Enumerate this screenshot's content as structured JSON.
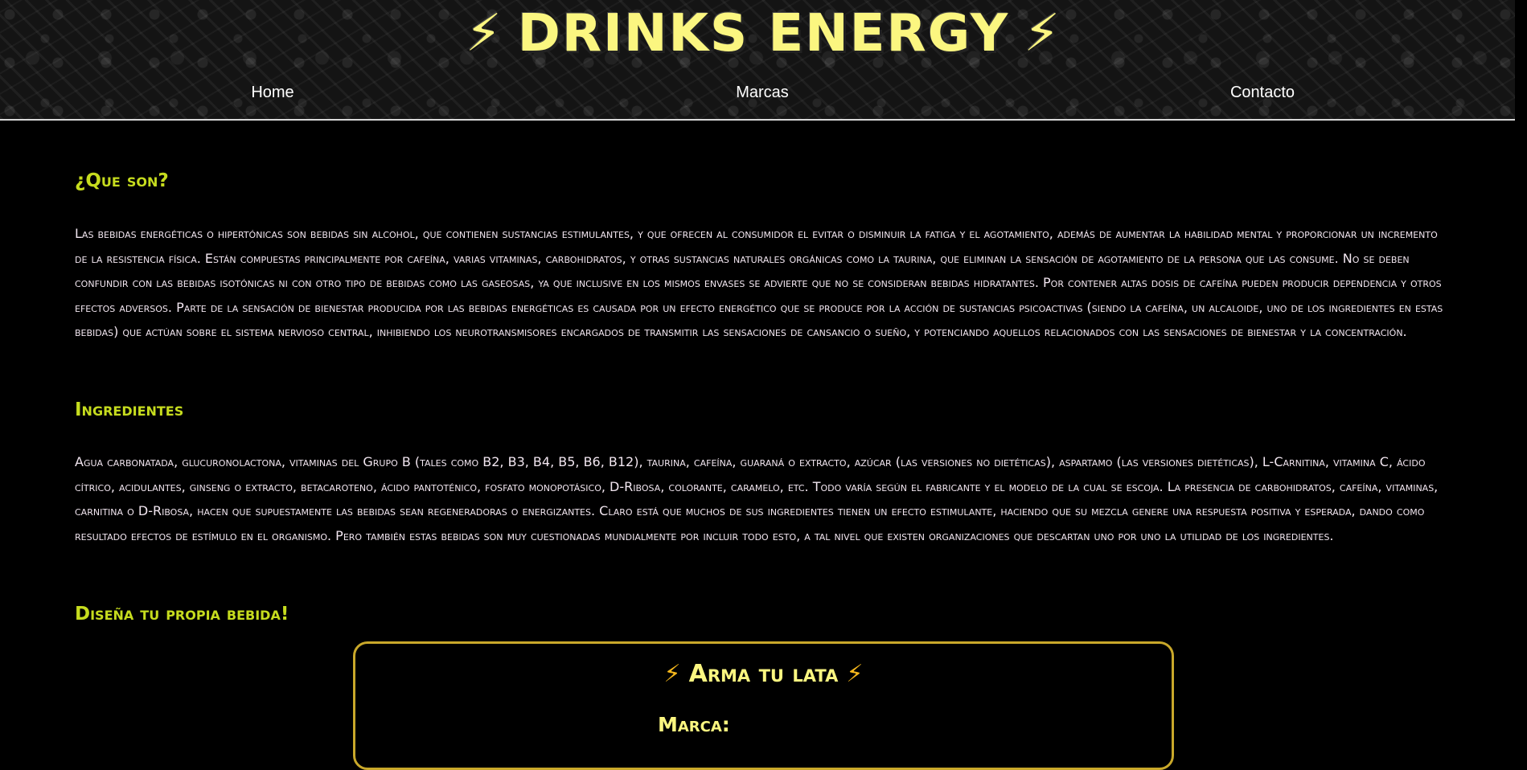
{
  "header": {
    "logo_bolt": "⚡",
    "logo_text": "DRINKS ENERGY",
    "nav": [
      {
        "label": "Home"
      },
      {
        "label": "Marcas"
      },
      {
        "label": "Contacto"
      }
    ]
  },
  "sections": [
    {
      "title": "¿Que son?",
      "text": "Las bebidas energéticas o hipertónicas son bebidas sin alcohol, que contienen sustancias estimulantes, y que ofrecen al consumidor el evitar o disminuir la fatiga y el agotamiento, además de aumentar la habilidad mental y proporcionar un incremento de la resistencia física. Están compuestas principalmente por cafeína, varias vitaminas, carbohidratos, y otras sustancias naturales orgánicas como la taurina, que eliminan la sensación de agotamiento de la persona que las consume. No se deben confundir con las bebidas isotónicas ni con otro tipo de bebidas como las gaseosas, ya que inclusive en los mismos envases se advierte que no se consideran bebidas hidratantes. Por contener altas dosis de cafeína pueden producir dependencia y otros efectos adversos. Parte de la sensación de bienestar producida por las bebidas energéticas es causada por un efecto energético que se produce por la acción de sustancias psicoactivas (siendo la cafeína, un alcaloide, uno de los ingredientes en estas bebidas) que actúan sobre el sistema nervioso central, inhibiendo los neurotransmisores encargados de transmitir las sensaciones de cansancio o sueño, y potenciando aquellos relacionados con las sensaciones de bienestar y la concentración."
    },
    {
      "title": "Ingredientes",
      "text": "Agua carbonatada, glucuronolactona, vitaminas del Grupo B (tales como B2, B3, B4, B5, B6, B12), taurina, cafeína, guaraná o extracto, azúcar (las versiones no dietéticas), aspartamo (las versiones dietéticas), L-Carnitina, vitamina C, ácido cítrico, acidulantes, ginseng o extracto, betacaroteno, ácido pantoténico, fosfato monopotásico, D-Ribosa, colorante, caramelo, etc. Todo varía según el fabricante y el modelo de la cual se escoja. La presencia de carbohidratos, cafeína, vitaminas, carnitina o D-Ribosa, hacen que supuestamente las bebidas sean regeneradoras o energizantes. Claro está que muchos de sus ingredientes tienen un efecto estimulante, haciendo que su mezcla genere una respuesta positiva y esperada, dando como resultado efectos de estímulo en el organismo. Pero también estas bebidas son muy cuestionadas mundialmente por incluir todo esto, a tal nivel que existen organizaciones que descartan uno por uno la utilidad de los ingredientes."
    },
    {
      "title": "Diseña tu propia bebida!"
    }
  ],
  "builder": {
    "bolt": "⚡",
    "title": "Arma tu lata",
    "brand_label": "Marca:"
  },
  "colors": {
    "accent": "#c6dc1e",
    "logo": "#fbf680",
    "card_border": "#c9a82a",
    "bolt": "#f5b71c"
  }
}
